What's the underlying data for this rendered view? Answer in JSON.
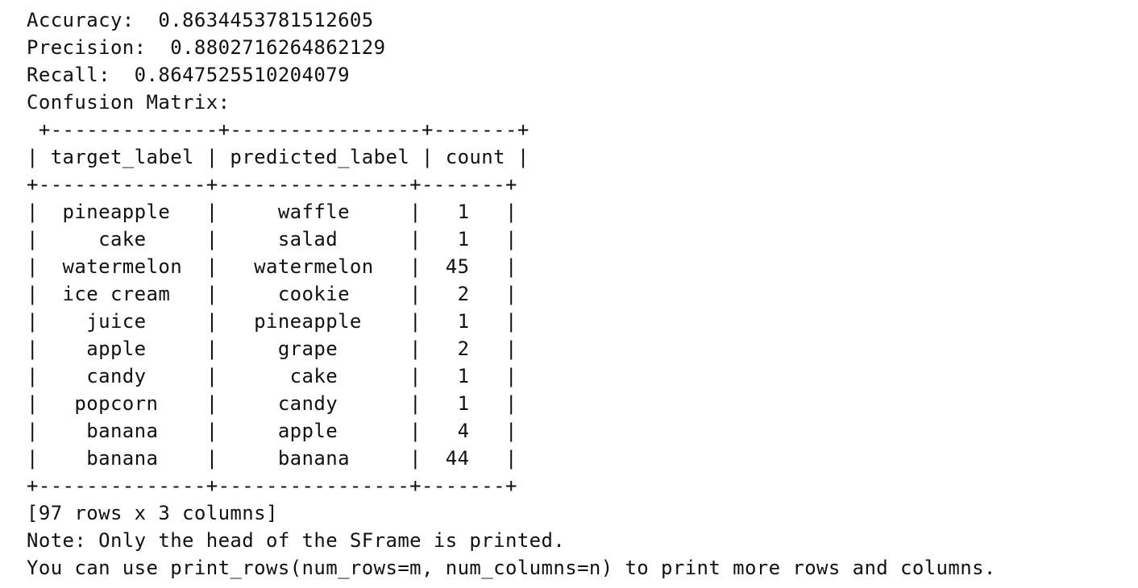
{
  "output": {
    "lines": [
      "Accuracy:  0.8634453781512605",
      "Precision:  0.8802716264862129",
      "Recall:  0.8647525510204079",
      "Confusion Matrix:",
      " +--------------+----------------+-------+",
      "| target_label | predicted_label | count |",
      "+--------------+----------------+-------+",
      "|  pineapple   |     waffle     |   1   |",
      "|     cake     |     salad      |   1   |",
      "|  watermelon  |   watermelon   |  45   |",
      "|  ice cream   |     cookie     |   2   |",
      "|    juice     |   pineapple    |   1   |",
      "|    apple     |     grape      |   2   |",
      "|    candy     |      cake      |   1   |",
      "|   popcorn    |     candy      |   1   |",
      "|    banana    |     apple      |   4   |",
      "|    banana    |     banana     |  44   |",
      "+--------------+----------------+-------+",
      "[97 rows x 3 columns]",
      "Note: Only the head of the SFrame is printed.",
      "You can use print_rows(num_rows=m, num_columns=n) to print more rows and columns."
    ]
  }
}
